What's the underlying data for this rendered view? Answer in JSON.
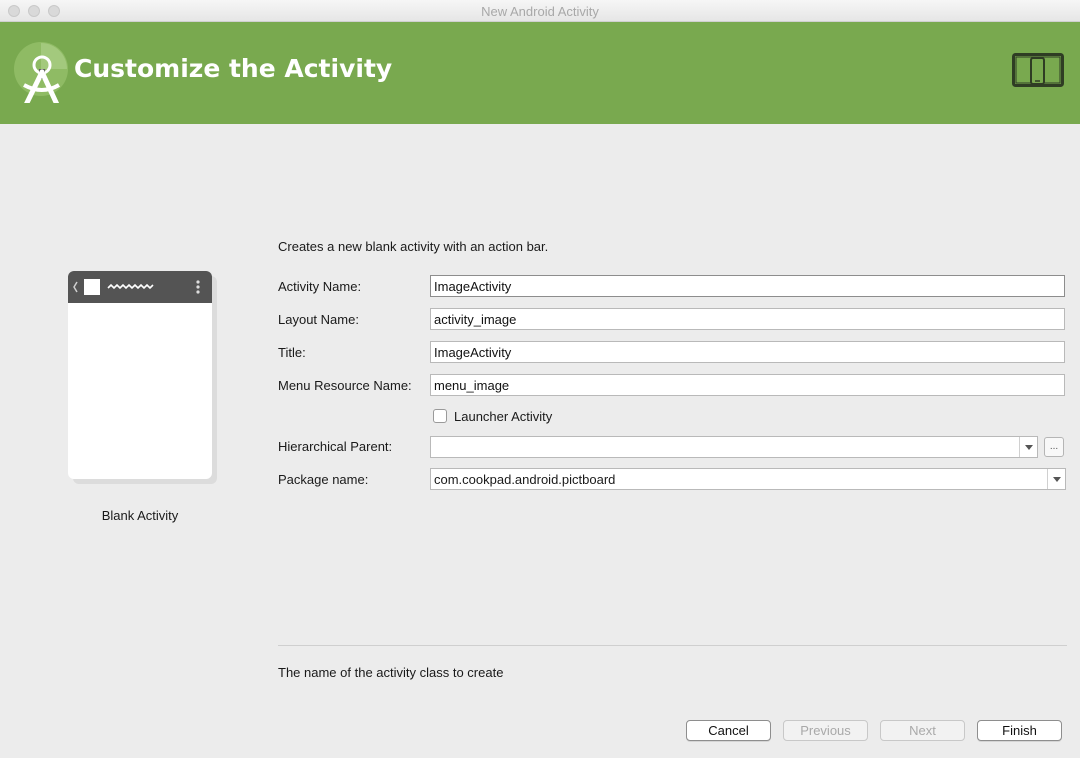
{
  "window": {
    "title": "New Android Activity"
  },
  "header": {
    "title": "Customize the Activity",
    "background": "#79a94f"
  },
  "preview": {
    "template_name": "Blank Activity"
  },
  "form": {
    "description": "Creates a new blank activity with an action bar.",
    "activity_name": {
      "label": "Activity Name:",
      "value": "ImageActivity"
    },
    "layout_name": {
      "label": "Layout Name:",
      "value": "activity_image"
    },
    "title": {
      "label": "Title:",
      "value": "ImageActivity"
    },
    "menu_resource_name": {
      "label": "Menu Resource Name:",
      "value": "menu_image"
    },
    "launcher_activity": {
      "label": "Launcher Activity",
      "checked": false
    },
    "hierarchical_parent": {
      "label": "Hierarchical Parent:",
      "value": "",
      "browse_label": "..."
    },
    "package_name": {
      "label": "Package name:",
      "value": "com.cookpad.android.pictboard"
    },
    "help_text": "The name of the activity class to create"
  },
  "buttons": {
    "cancel": "Cancel",
    "previous": "Previous",
    "next": "Next",
    "finish": "Finish"
  }
}
